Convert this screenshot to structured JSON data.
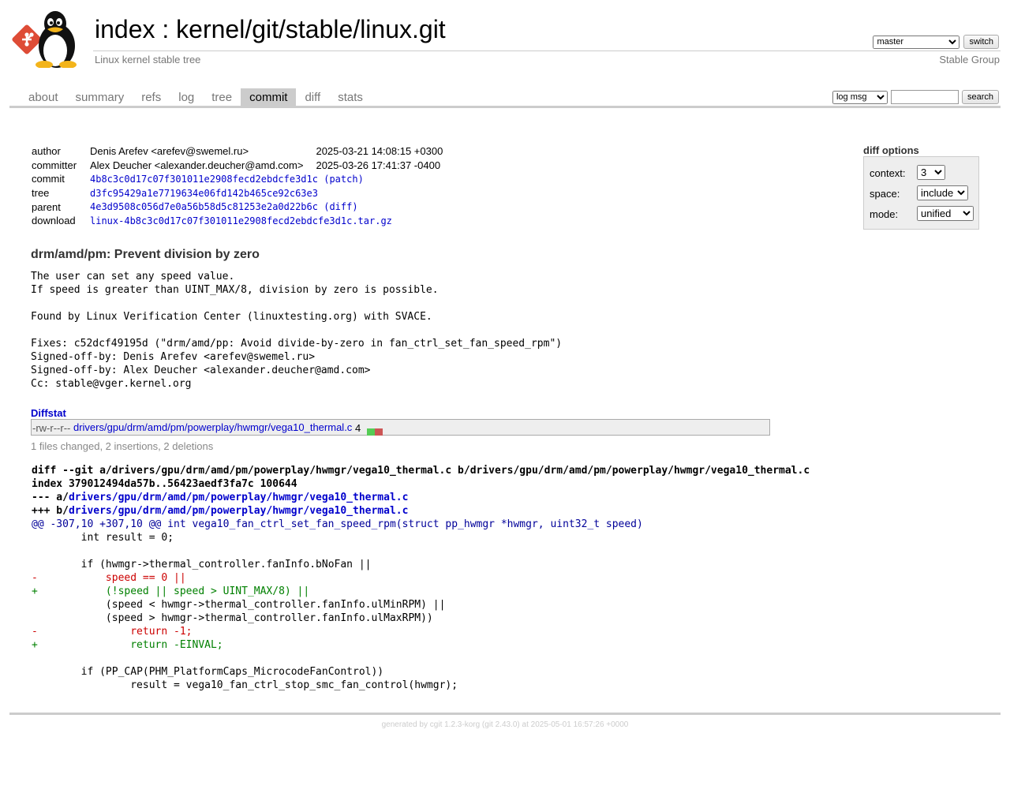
{
  "header": {
    "index_label": "index",
    "separator": " : ",
    "repo_path": "kernel/git/stable/linux.git",
    "description": "Linux kernel stable tree",
    "owner": "Stable Group",
    "branch_selected": "master",
    "switch_label": "switch"
  },
  "tabs": [
    {
      "label": "about"
    },
    {
      "label": "summary"
    },
    {
      "label": "refs"
    },
    {
      "label": "log"
    },
    {
      "label": "tree"
    },
    {
      "label": "commit",
      "active": true
    },
    {
      "label": "diff"
    },
    {
      "label": "stats"
    }
  ],
  "search": {
    "mode_selected": "log msg",
    "query": "",
    "button_label": "search"
  },
  "commit": {
    "author_label": "author",
    "author": "Denis Arefev <arefev@swemel.ru>",
    "author_date": "2025-03-21 14:08:15 +0300",
    "committer_label": "committer",
    "committer": "Alex Deucher <alexander.deucher@amd.com>",
    "committer_date": "2025-03-26 17:41:37 -0400",
    "commit_label": "commit",
    "commit_hash": "4b8c3c0d17c07f301011e2908fecd2ebdcfe3d1c",
    "patch_link": "(patch)",
    "tree_label": "tree",
    "tree_hash": "d3fc95429a1e7719634e06fd142b465ce92c63e3",
    "parent_label": "parent",
    "parent_hash": "4e3d9508c056d7e0a56b58d5c81253e2a0d22b6c",
    "diff_link": "(diff)",
    "download_label": "download",
    "download_file": "linux-4b8c3c0d17c07f301011e2908fecd2ebdcfe3d1c.tar.gz"
  },
  "diff_options": {
    "title": "diff options",
    "context_label": "context:",
    "context_value": "3",
    "space_label": "space:",
    "space_value": "include",
    "mode_label": "mode:",
    "mode_value": "unified"
  },
  "message": {
    "subject": "drm/amd/pm: Prevent division by zero",
    "body": "The user can set any speed value.\nIf speed is greater than UINT_MAX/8, division by zero is possible.\n\nFound by Linux Verification Center (linuxtesting.org) with SVACE.\n\nFixes: c52dcf49195d (\"drm/amd/pp: Avoid divide-by-zero in fan_ctrl_set_fan_speed_rpm\")\nSigned-off-by: Denis Arefev <arefev@swemel.ru>\nSigned-off-by: Alex Deucher <alexander.deucher@amd.com>\nCc: stable@vger.kernel.org"
  },
  "diffstat": {
    "header": "Diffstat",
    "mode": "-rw-r--r--",
    "file": "drivers/gpu/drm/amd/pm/powerplay/hwmgr/vega10_thermal.c",
    "changes": "4",
    "insertions": 2,
    "deletions": 2,
    "add_color": "#5c5",
    "del_color": "#c55",
    "summary": "1 files changed, 2 insertions, 2 deletions"
  },
  "diff": {
    "git_line": "diff --git a/drivers/gpu/drm/amd/pm/powerplay/hwmgr/vega10_thermal.c b/drivers/gpu/drm/amd/pm/powerplay/hwmgr/vega10_thermal.c",
    "index_line": "index 379012494da57b..56423aedf3fa7c 100644",
    "old_prefix": "--- a/",
    "old_file": "drivers/gpu/drm/amd/pm/powerplay/hwmgr/vega10_thermal.c",
    "new_prefix": "+++ b/",
    "new_file": "drivers/gpu/drm/amd/pm/powerplay/hwmgr/vega10_thermal.c",
    "lines": [
      {
        "type": "hunk",
        "text": "@@ -307,10 +307,10 @@ int vega10_fan_ctrl_set_fan_speed_rpm(struct pp_hwmgr *hwmgr, uint32_t speed)"
      },
      {
        "type": "ctx",
        "text": " \tint result = 0;"
      },
      {
        "type": "ctx",
        "text": " "
      },
      {
        "type": "ctx",
        "text": " \tif (hwmgr->thermal_controller.fanInfo.bNoFan ||"
      },
      {
        "type": "del",
        "text": "-\t    speed == 0 ||"
      },
      {
        "type": "add",
        "text": "+\t    (!speed || speed > UINT_MAX/8) ||"
      },
      {
        "type": "ctx",
        "text": " \t    (speed < hwmgr->thermal_controller.fanInfo.ulMinRPM) ||"
      },
      {
        "type": "ctx",
        "text": " \t    (speed > hwmgr->thermal_controller.fanInfo.ulMaxRPM))"
      },
      {
        "type": "del",
        "text": "-\t\treturn -1;"
      },
      {
        "type": "add",
        "text": "+\t\treturn -EINVAL;"
      },
      {
        "type": "ctx",
        "text": " "
      },
      {
        "type": "ctx",
        "text": " \tif (PP_CAP(PHM_PlatformCaps_MicrocodeFanControl))"
      },
      {
        "type": "ctx",
        "text": " \t\tresult = vega10_fan_ctrl_stop_smc_fan_control(hwmgr);"
      }
    ]
  },
  "footer": {
    "prefix": "generated by ",
    "cgit_version": "cgit 1.2.3-korg",
    "git_version_open": " (",
    "git_version": "git 2.43.0",
    "suffix": ") at 2025-05-01 16:57:26 +0000"
  }
}
